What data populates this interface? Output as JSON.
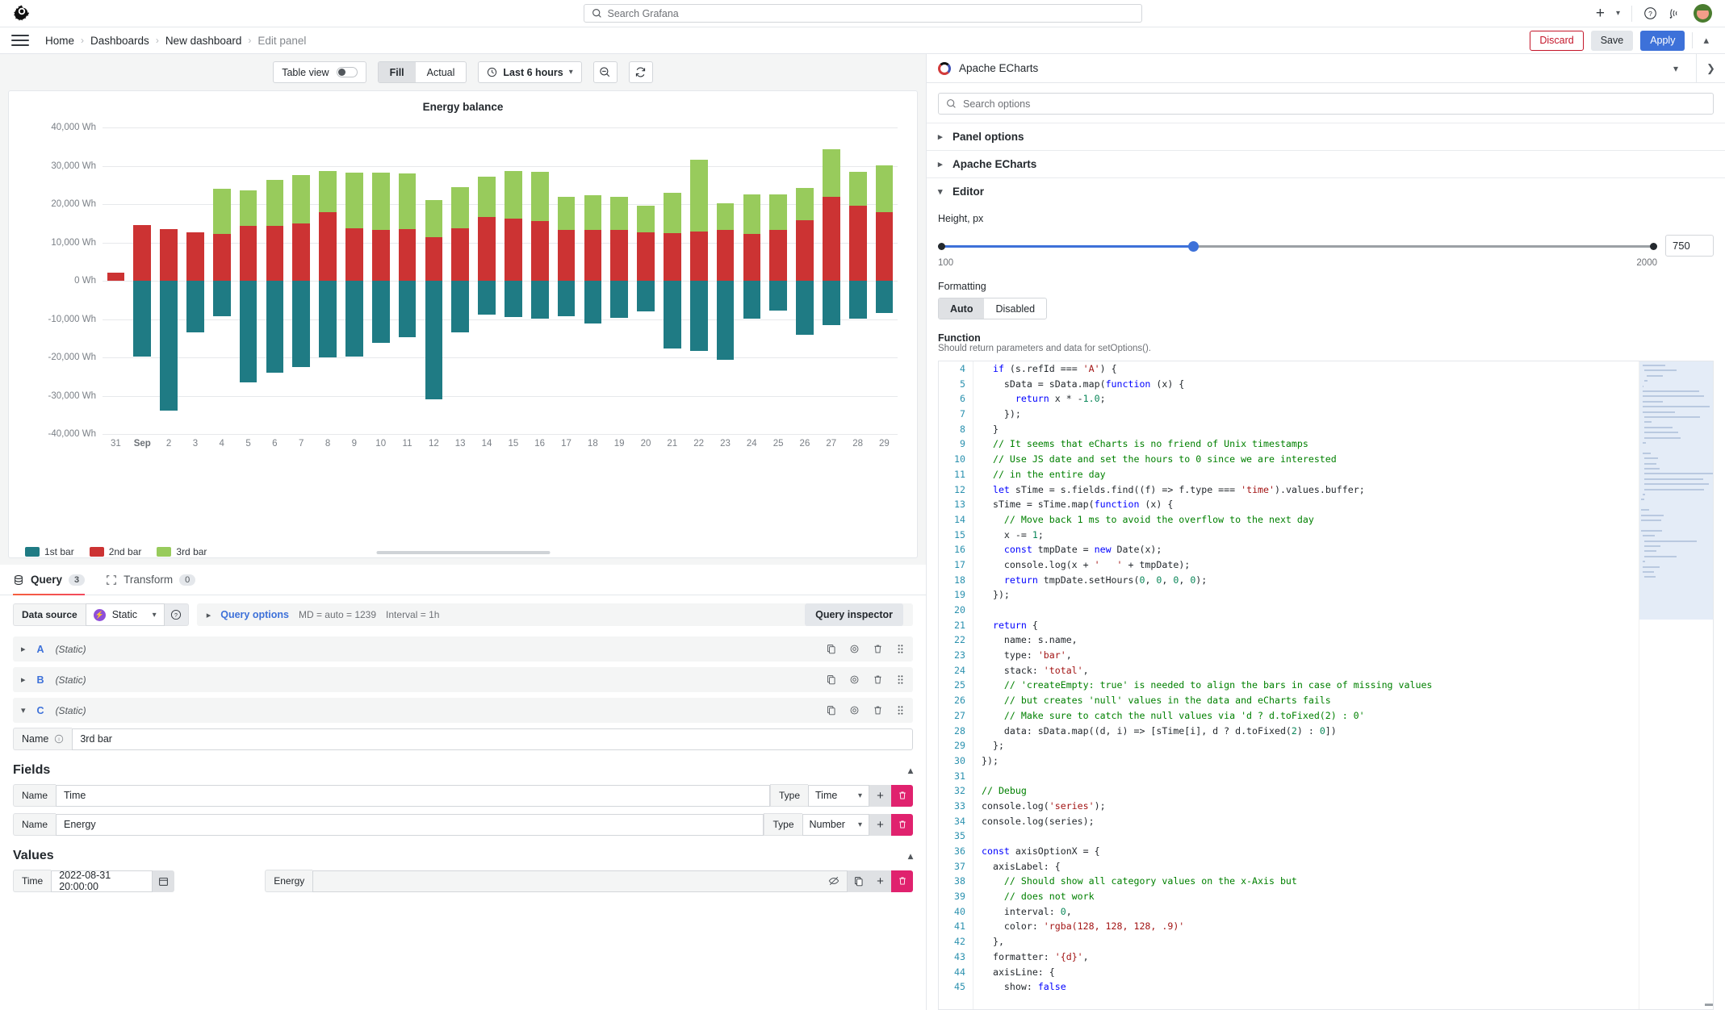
{
  "topbar": {
    "logo_icon": "grafana-logo-icon",
    "search_placeholder": "Search Grafana",
    "search_icon": "search-icon",
    "plus_icon": "plus-icon",
    "plus_chevron_icon": "chevron-down-icon",
    "help_icon": "help-circle-icon",
    "news_icon": "rss-feed-icon",
    "avatar_label": "user-avatar"
  },
  "breadcrumb": {
    "menu_icon": "hamburger-menu-icon",
    "items": [
      "Home",
      "Dashboards",
      "New dashboard",
      "Edit panel"
    ],
    "separator": "›",
    "actions": {
      "discard": "Discard",
      "save": "Save",
      "apply": "Apply",
      "collapse_icon": "chevron-up-icon"
    }
  },
  "panel_toolbar": {
    "table_view_label": "Table view",
    "table_view_on": false,
    "fill_label": "Fill",
    "actual_label": "Actual",
    "fill_selected": true,
    "time_range": "Last 6 hours",
    "time_icon": "clock-icon",
    "time_chevron": "chevron-down-icon",
    "zoom_out_icon": "zoom-out-icon",
    "refresh_icon": "refresh-icon"
  },
  "panel": {
    "title": "Energy balance",
    "legend": [
      {
        "label": "1st bar",
        "color": "#1f7b84"
      },
      {
        "label": "2nd bar",
        "color": "#cc3333"
      },
      {
        "label": "3rd bar",
        "color": "#98cb5c"
      }
    ]
  },
  "chart_data": {
    "type": "bar",
    "title": "Energy balance",
    "stacked": true,
    "xlabel": "",
    "ylabel": "",
    "ylim": [
      -40000,
      40000
    ],
    "ytick_labels": [
      "40,000 Wh",
      "30,000 Wh",
      "20,000 Wh",
      "10,000 Wh",
      "0 Wh",
      "-10,000 Wh",
      "-20,000 Wh",
      "-30,000 Wh",
      "-40,000 Wh"
    ],
    "yticks": [
      40000,
      30000,
      20000,
      10000,
      0,
      -10000,
      -20000,
      -30000,
      -40000
    ],
    "grid": true,
    "legend_position": "bottom-left",
    "categories": [
      "31",
      "Sep",
      "2",
      "3",
      "4",
      "5",
      "6",
      "7",
      "8",
      "9",
      "10",
      "11",
      "12",
      "13",
      "14",
      "15",
      "16",
      "17",
      "18",
      "19",
      "20",
      "21",
      "22",
      "23",
      "24",
      "25",
      "26",
      "27",
      "28",
      "29"
    ],
    "series": [
      {
        "name": "1st bar",
        "color": "#1f7b84",
        "values": [
          0,
          -19800,
          -33800,
          -13500,
          -9200,
          -26500,
          -24100,
          -22600,
          -19900,
          -19700,
          -16200,
          -14800,
          -30900,
          -13500,
          -8900,
          -9500,
          -9900,
          -9200,
          -11100,
          -9600,
          -8100,
          -17600,
          -18300,
          -20600,
          -9900,
          -7800,
          -14000,
          -11600,
          -9800,
          -8500
        ]
      },
      {
        "name": "2nd bar",
        "color": "#cc3333",
        "values": [
          2100,
          14600,
          13400,
          12600,
          12300,
          14300,
          14400,
          15000,
          17900,
          13700,
          13200,
          13400,
          11400,
          13600,
          16700,
          16300,
          15500,
          13200,
          13300,
          13200,
          12700,
          12500,
          12900,
          13300,
          12200,
          13200,
          15800,
          21900,
          19500,
          17900
        ]
      },
      {
        "name": "3rd bar",
        "color": "#98cb5c",
        "values": [
          0,
          0,
          0,
          0,
          11700,
          9300,
          11900,
          12500,
          10800,
          14600,
          15000,
          14700,
          9600,
          10800,
          10400,
          12300,
          12900,
          8700,
          9100,
          8700,
          6900,
          10400,
          18700,
          7000,
          10300,
          9300,
          8400,
          12400,
          9000,
          12200
        ]
      }
    ]
  },
  "query_section": {
    "tabs": [
      {
        "label": "Query",
        "count": "3",
        "icon": "database-icon",
        "active": true
      },
      {
        "label": "Transform",
        "count": "0",
        "icon": "transform-icon",
        "active": false
      }
    ],
    "data_source_label": "Data source",
    "data_source_value": "Static",
    "data_source_icon": "static-datasource-icon",
    "help_icon": "help-circle-icon",
    "query_options_label": "Query options",
    "query_options_meta_md": "MD = auto = 1239",
    "query_options_meta_interval": "Interval = 1h",
    "query_inspector_label": "Query inspector",
    "rows": [
      {
        "ref": "A",
        "datasource": "(Static)",
        "expanded": false
      },
      {
        "ref": "B",
        "datasource": "(Static)",
        "expanded": false
      },
      {
        "ref": "C",
        "datasource": "(Static)",
        "expanded": true
      }
    ],
    "row_icons": [
      "duplicate-icon",
      "hide-response-icon",
      "trash-icon",
      "drag-handle-icon"
    ],
    "name_label": "Name",
    "name_value": "3rd bar",
    "fields": {
      "title": "Fields",
      "name_label": "Name",
      "type_label": "Type",
      "rows": [
        {
          "name": "Time",
          "type": "Time"
        },
        {
          "name": "Energy",
          "type": "Number"
        }
      ],
      "add_icon": "plus-icon",
      "delete_icon": "trash-icon"
    },
    "values": {
      "title": "Values",
      "time_label": "Time",
      "time_value": "2022-08-31 20:00:00",
      "calendar_icon": "calendar-icon",
      "energy_label": "Energy",
      "energy_value": "",
      "hide_icon": "eye-slash-icon",
      "duplicate_icon": "duplicate-icon",
      "add_icon": "plus-icon",
      "delete_icon": "trash-icon"
    }
  },
  "options_pane": {
    "viz_name": "Apache ECharts",
    "viz_icon": "apache-echarts-logo-icon",
    "viz_chevron_icon": "chevron-down-icon",
    "collapse_pane_icon": "chevron-right-icon",
    "search_placeholder": "Search options",
    "search_icon": "search-icon",
    "sections": [
      {
        "label": "Panel options",
        "expanded": false
      },
      {
        "label": "Apache ECharts",
        "expanded": false
      },
      {
        "label": "Editor",
        "expanded": true
      }
    ],
    "editor": {
      "height_label": "Height, px",
      "height_value": "750",
      "height_min": "100",
      "height_max": "2000",
      "formatting_label": "Formatting",
      "formatting_auto": "Auto",
      "formatting_disabled": "Disabled",
      "formatting_selected": "Auto",
      "function_label": "Function",
      "function_desc": "Should return parameters and data for setOptions().",
      "code_first_line": 4,
      "code_lines": [
        "  if (s.refId === 'A') {",
        "    sData = sData.map(function (x) {",
        "      return x * -1.0;",
        "    });",
        "  }",
        "  // It seems that eCharts is no friend of Unix timestamps",
        "  // Use JS date and set the hours to 0 since we are interested",
        "  // in the entire day",
        "  let sTime = s.fields.find((f) => f.type === 'time').values.buffer;",
        "  sTime = sTime.map(function (x) {",
        "    // Move back 1 ms to avoid the overflow to the next day",
        "    x -= 1;",
        "    const tmpDate = new Date(x);",
        "    console.log(x + '   ' + tmpDate);",
        "    return tmpDate.setHours(0, 0, 0, 0);",
        "  });",
        "",
        "  return {",
        "    name: s.name,",
        "    type: 'bar',",
        "    stack: 'total',",
        "    // 'createEmpty: true' is needed to align the bars in case of missing values",
        "    // but creates 'null' values in the data and eCharts fails",
        "    // Make sure to catch the null values via 'd ? d.toFixed(2) : 0'",
        "    data: sData.map((d, i) => [sTime[i], d ? d.toFixed(2) : 0])",
        "  };",
        "});",
        "",
        "// Debug",
        "console.log('series');",
        "console.log(series);",
        "",
        "const axisOptionX = {",
        "  axisLabel: {",
        "    // Should show all category values on the x-Axis but",
        "    // does not work",
        "    interval: 0,",
        "    color: 'rgba(128, 128, 128, .9)'",
        "  },",
        "  formatter: '{d}',",
        "  axisLine: {",
        "    show: false"
      ]
    }
  },
  "colors": {
    "accent_blue": "#3d71d9",
    "danger_red": "#c4162a",
    "pink": "#e0226e",
    "series_teal": "#1f7b84",
    "series_red": "#cc3333",
    "series_green": "#98cb5c"
  }
}
